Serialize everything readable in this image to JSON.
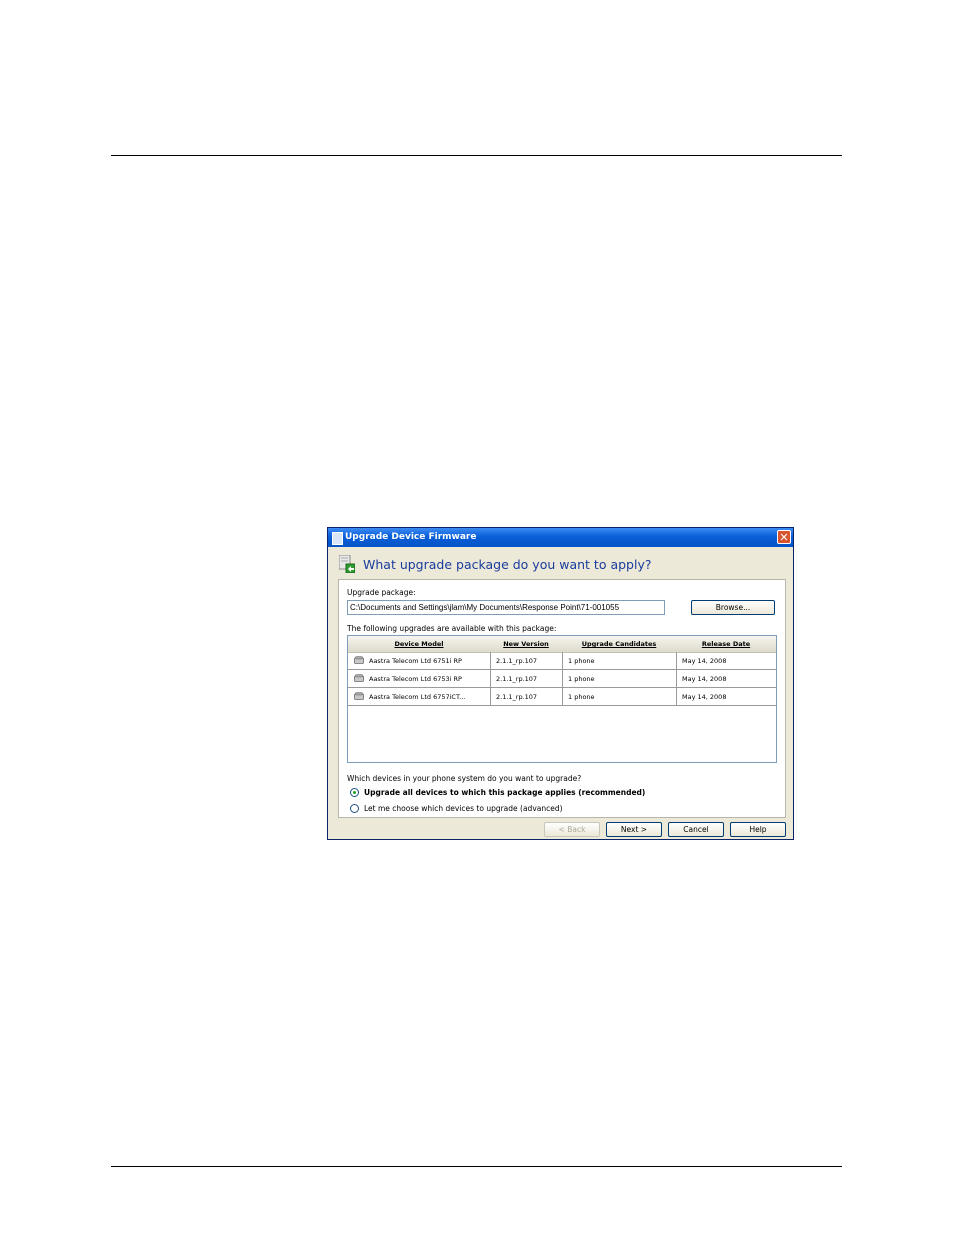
{
  "window": {
    "title": "Upgrade Device Firmware",
    "close_glyph": "✕"
  },
  "heading": "What upgrade package do you want to apply?",
  "package": {
    "label": "Upgrade package:",
    "path_value": "C:\\Documents and Settings\\jlam\\My Documents\\Response Point\\71-001055",
    "browse_label": "Browse..."
  },
  "table": {
    "intro": "The following upgrades are available with this package:",
    "columns": [
      "Device Model",
      "New Version",
      "Upgrade Candidates",
      "Release Date"
    ],
    "rows": [
      [
        "Aastra Telecom Ltd 6751i RP",
        "2.1.1_rp.107",
        "1 phone",
        "May 14, 2008"
      ],
      [
        "Aastra Telecom Ltd 6753i RP",
        "2.1.1_rp.107",
        "1 phone",
        "May 14, 2008"
      ],
      [
        "Aastra Telecom Ltd 6757iCT...",
        "2.1.1_rp.107",
        "1 phone",
        "May 14, 2008"
      ]
    ]
  },
  "devices": {
    "question": "Which devices in your phone system do you want to upgrade?",
    "option_all": "Upgrade all devices to which this package applies (recommended)",
    "option_choose": "Let me choose which devices to upgrade (advanced)",
    "selected": "all"
  },
  "buttons": {
    "back": "< Back",
    "next": "Next >",
    "cancel": "Cancel",
    "help": "Help"
  },
  "colors": {
    "title_bar": "#0a5fd8",
    "heading_text": "#1a3c9e",
    "close_button": "#d9542f"
  },
  "icons": {
    "app": "firmware-app-icon",
    "header": "upgrade-package-icon",
    "row": "phone-icon",
    "close": "close-icon"
  }
}
